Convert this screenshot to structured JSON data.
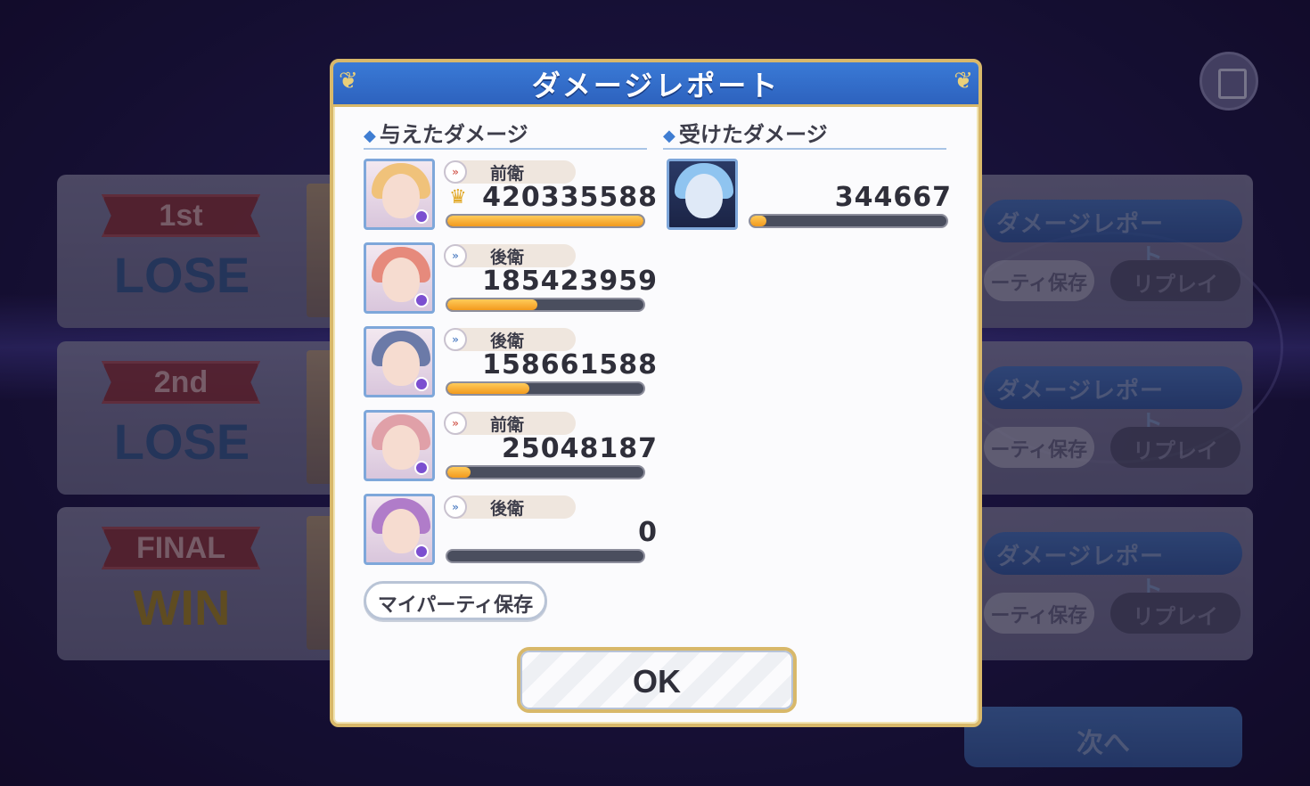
{
  "background": {
    "rounds": [
      {
        "label": "1st",
        "result": "LOSE",
        "result_type": "lose"
      },
      {
        "label": "2nd",
        "result": "LOSE",
        "result_type": "lose"
      },
      {
        "label": "FINAL",
        "result": "WIN",
        "result_type": "win"
      }
    ],
    "report_button_label": "ダメージレポート",
    "save_button_label": "ーティ保存",
    "replay_button_label": "リプレイ",
    "next_button_label": "次へ"
  },
  "dialog": {
    "title": "ダメージレポート",
    "dealt_header": "与えたダメージ",
    "taken_header": "受けたダメージ",
    "dealt": [
      {
        "position": "前衛",
        "position_type": "front",
        "damage": "420335588",
        "fill": 1.0,
        "top": true,
        "hair": "#f0c27a"
      },
      {
        "position": "後衛",
        "position_type": "back",
        "damage": "185423959",
        "fill": 0.46,
        "top": false,
        "hair": "#e68a7c"
      },
      {
        "position": "後衛",
        "position_type": "back",
        "damage": "158661588",
        "fill": 0.42,
        "top": false,
        "hair": "#6b7aa8"
      },
      {
        "position": "前衛",
        "position_type": "front",
        "damage": "25048187",
        "fill": 0.12,
        "top": false,
        "hair": "#e0a0a8"
      },
      {
        "position": "後衛",
        "position_type": "back",
        "damage": "0",
        "fill": 0.0,
        "top": false,
        "hair": "#b07cc9"
      }
    ],
    "taken": [
      {
        "damage": "344667",
        "fill": 0.08,
        "hair": "#8fc4f0"
      }
    ],
    "save_party_label": "マイパーティ保存",
    "ok_label": "OK"
  },
  "colors": {
    "header_blue": "#2d62be",
    "gold_border": "#d8b86a",
    "bar_fill": "#f29a1e"
  }
}
